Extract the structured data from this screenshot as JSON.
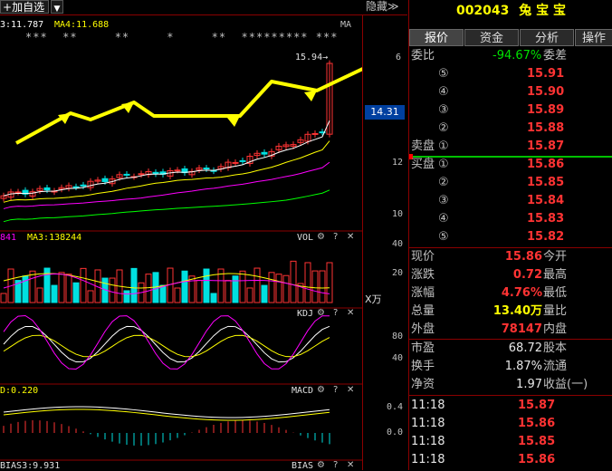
{
  "toolbar": {
    "add_label": "加自选",
    "hide_label": "隐藏",
    "hide_arrow": "≫"
  },
  "main_chart": {
    "ma_text": "3:11.787",
    "ma4_text": "MA4:11.688",
    "ma_tag": "MA",
    "stars": "***  **     **     *     **  ********* ***",
    "peak_label": "15.94→",
    "price_badge": "14.31",
    "yticks": [
      "6",
      "12",
      "10"
    ]
  },
  "vol_panel": {
    "ma_text": "841",
    "ma3_text": "MA3:138244",
    "name": "VOL",
    "yticks": [
      "40",
      "20"
    ],
    "unit": "X万"
  },
  "kdj_panel": {
    "name": "KDJ",
    "yticks": [
      "80",
      "40"
    ]
  },
  "macd_panel": {
    "left_text": "D:0.220",
    "name": "MACD",
    "yticks": [
      "0.4",
      "0.0"
    ]
  },
  "bias_panel": {
    "left_text": "BIAS3:9.931",
    "name": "BIAS"
  },
  "panel_icons": {
    "gear": "⚙",
    "help": "?",
    "close": "✕"
  },
  "stock": {
    "code": "002043",
    "name": "兔 宝 宝"
  },
  "tabs": [
    {
      "label": "报价",
      "active": true
    },
    {
      "label": "资金",
      "active": false
    },
    {
      "label": "分析",
      "active": false
    },
    {
      "label": "操作",
      "active": false
    }
  ],
  "weibi": {
    "label": "委比",
    "value": "-94.67%",
    "label2": "委差"
  },
  "sell_orders": [
    {
      "level": "⑤",
      "price": "15.91"
    },
    {
      "level": "④",
      "price": "15.90"
    },
    {
      "level": "③",
      "price": "15.89"
    },
    {
      "level": "②",
      "price": "15.88"
    },
    {
      "level": "①",
      "price": "15.87",
      "prefix": "卖盘"
    }
  ],
  "buy_orders": [
    {
      "level": "①",
      "price": "15.86",
      "prefix": "买盘"
    },
    {
      "level": "②",
      "price": "15.85"
    },
    {
      "level": "③",
      "price": "15.84"
    },
    {
      "level": "④",
      "price": "15.83"
    },
    {
      "level": "⑤",
      "price": "15.82"
    }
  ],
  "quote": [
    {
      "l1": "现价",
      "v1": "15.86",
      "l2": "今开",
      "color": "red"
    },
    {
      "l1": "涨跌",
      "v1": "0.72",
      "l2": "最高",
      "color": "red"
    },
    {
      "l1": "涨幅",
      "v1": "4.76%",
      "l2": "最低",
      "color": "red"
    },
    {
      "l1": "总量",
      "v1": "13.40万",
      "l2": "量比",
      "color": "yellow"
    },
    {
      "l1": "外盘",
      "v1": "78147",
      "l2": "内盘",
      "color": "red"
    }
  ],
  "quote2": [
    {
      "l1": "市盈",
      "v1": "68.72",
      "l2": "股本"
    },
    {
      "l1": "换手",
      "v1": "1.87%",
      "l2": "流通"
    },
    {
      "l1": "净资",
      "v1": "1.97",
      "l2": "收益(一)"
    }
  ],
  "ticks": [
    {
      "time": "11:18",
      "price": "15.87"
    },
    {
      "time": "11:18",
      "price": "15.86"
    },
    {
      "time": "11:18",
      "price": "15.85"
    },
    {
      "time": "11:18",
      "price": "15.86"
    }
  ],
  "colors": {
    "up": "#ff3333",
    "down": "#00e0e0",
    "ma5": "#ffffff",
    "ma10": "#ffff00",
    "ma20": "#ff00ff",
    "ma60": "#00ff00",
    "arrow": "#ffff00"
  }
}
